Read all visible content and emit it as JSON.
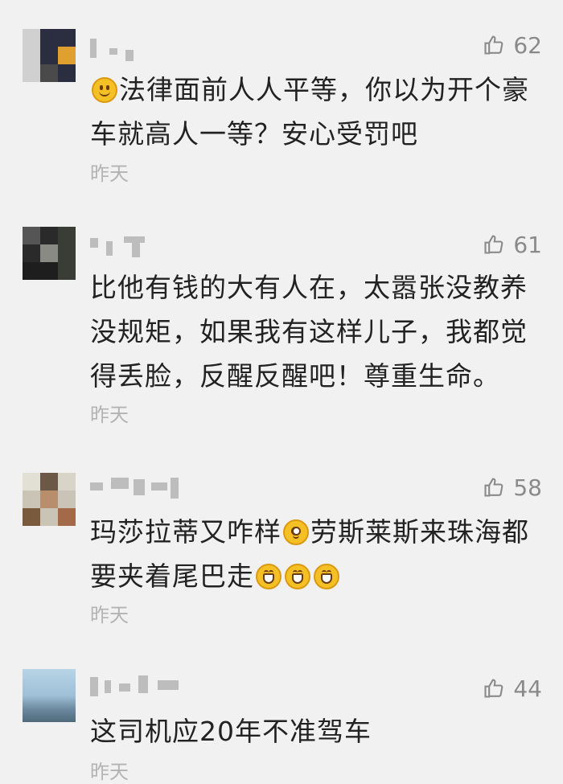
{
  "comments": [
    {
      "likes": "62",
      "text_lines": [
        "法律面前人人平等，你以为开个豪",
        "车就高人一等？安心受罚吧"
      ],
      "time": "昨天"
    },
    {
      "likes": "61",
      "text_lines": [
        "比他有钱的大有人在，太嚣张没教养",
        "没规矩，如果我有这样儿子，我都觉",
        "得丢脸，反醒反醒吧！尊重生命。"
      ],
      "time": "昨天"
    },
    {
      "likes": "58",
      "text_parts": [
        "玛莎拉蒂又咋样",
        "劳斯莱斯来珠海都",
        "要夹着尾巴走"
      ],
      "time": "昨天"
    },
    {
      "likes": "44",
      "text_lines": [
        "这司机应20年不准驾车"
      ],
      "time": "昨天"
    }
  ],
  "colors": {
    "background": "#f1f1f1",
    "text": "#222222",
    "meta": "#8a8a8a",
    "time": "#b3b3b3"
  },
  "icons": {
    "like": "thumbs-up-icon",
    "emoji_smile": "smile-emoji-icon",
    "emoji_dizzy": "dizzy-emoji-icon",
    "emoji_grin": "grin-emoji-icon"
  }
}
